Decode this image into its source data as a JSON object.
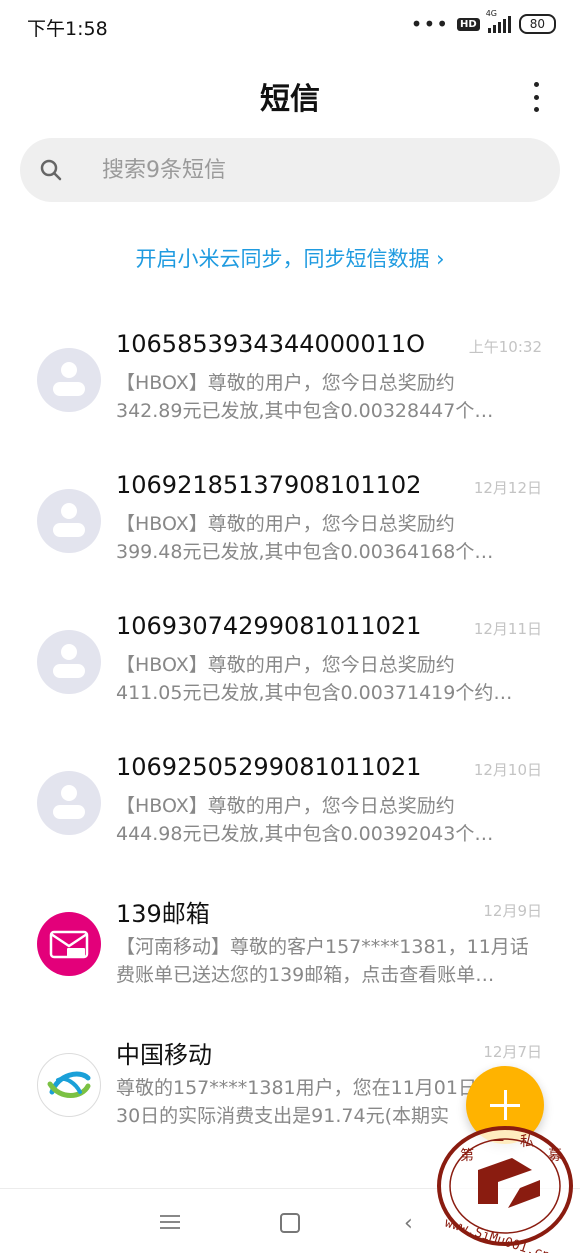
{
  "status_bar": {
    "time": "下午1:58",
    "hd": "HD",
    "network": "4G",
    "battery": "80"
  },
  "header": {
    "title": "短信"
  },
  "search": {
    "placeholder": "搜索9条短信"
  },
  "cloud_sync": {
    "text": "开启小米云同步，同步短信数据 ›"
  },
  "messages": [
    {
      "sender": "1065853934344000011O",
      "date": "上午10:32",
      "line1": "【HBOX】尊敬的用户，您今日总奖励约",
      "line2": "342.89元已发放,其中包含0.00328447个…",
      "avatar": "person-icon"
    },
    {
      "sender": "1069218513790810​1102",
      "date": "12月12日",
      "line1": "【HBOX】尊敬的用户，您今日总奖励约",
      "line2": "399.48元已发放,其中包含0.00364168个…",
      "avatar": "person-icon"
    },
    {
      "sender": "10693074299081011021",
      "date": "12月11日",
      "line1": "【HBOX】尊敬的用户，您今日总奖励约",
      "line2": "411.05元已发放,其中包含0.00371419个约…",
      "avatar": "person-icon"
    },
    {
      "sender": "10692505299081011021",
      "date": "12月10日",
      "line1": "【HBOX】尊敬的用户，您今日总奖励约",
      "line2": "444.98元已发放,其中包含0.00392043个…",
      "avatar": "person-icon"
    },
    {
      "sender": "139邮箱",
      "date": "12月9日",
      "line1": "【河南移动】尊敬的客户157****1381，11月话",
      "line2": "费账单已送达您的139邮箱，点击查看账单…",
      "avatar": "mail-139-icon",
      "avatar_text": "139"
    },
    {
      "sender": "中国移动",
      "date": "12月7日",
      "line1": "尊敬的157****1381用户，您在11月01日",
      "line2": "30日的实际消费支出是91.74元(本期实",
      "avatar": "china-mobile-logo-icon"
    }
  ],
  "fab": {
    "icon": "plus-icon",
    "color": "#ffb300"
  },
  "watermark": {
    "text": "www.SiMu001.cn",
    "chars": "第一私募"
  },
  "navbar": {
    "icons": [
      "menu-icon",
      "home-square-icon",
      "back-icon"
    ]
  },
  "colors": {
    "accent": "#1f9be0",
    "fab": "#ffb300",
    "mail_pink": "#e3007a"
  }
}
